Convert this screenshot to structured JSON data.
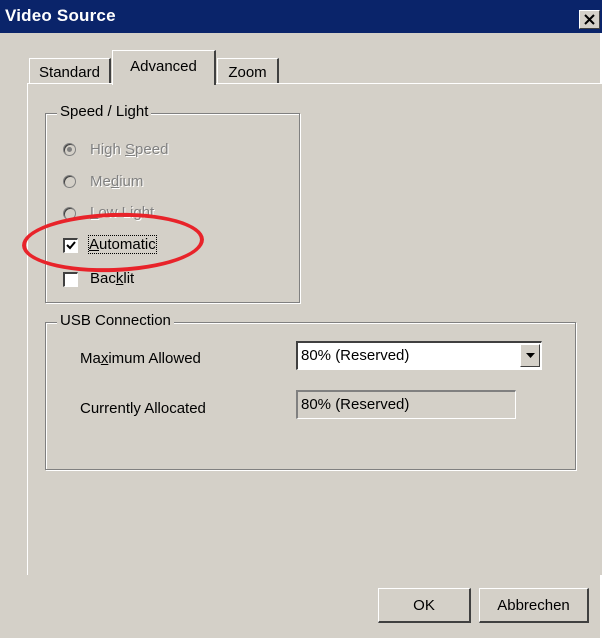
{
  "window": {
    "title": "Video Source",
    "close_glyph": "✕"
  },
  "tabs": [
    "Standard",
    "Advanced",
    "Zoom"
  ],
  "speed_light": {
    "title": "Speed / Light",
    "options": [
      {
        "pre": "High ",
        "key": "S",
        "post": "peed",
        "selected": true
      },
      {
        "pre": "Me",
        "key": "d",
        "post": "ium",
        "selected": false
      },
      {
        "pre": "",
        "key": "L",
        "post": "ow Light",
        "selected": false
      }
    ],
    "automatic": {
      "pre": "",
      "key": "A",
      "post": "utomatic",
      "checked": true
    },
    "backlit": {
      "pre": "Bac",
      "key": "k",
      "post": "lit",
      "checked": false
    }
  },
  "usb": {
    "title": "USB Connection",
    "max_label": {
      "pre": "Ma",
      "key": "x",
      "post": "imum Allowed"
    },
    "max_value": "80% (Reserved)",
    "alloc_label": "Currently Allocated",
    "alloc_value": "80% (Reserved)"
  },
  "buttons": {
    "ok": "OK",
    "cancel": "Abbrechen"
  },
  "annotation_color": "#e8232a"
}
